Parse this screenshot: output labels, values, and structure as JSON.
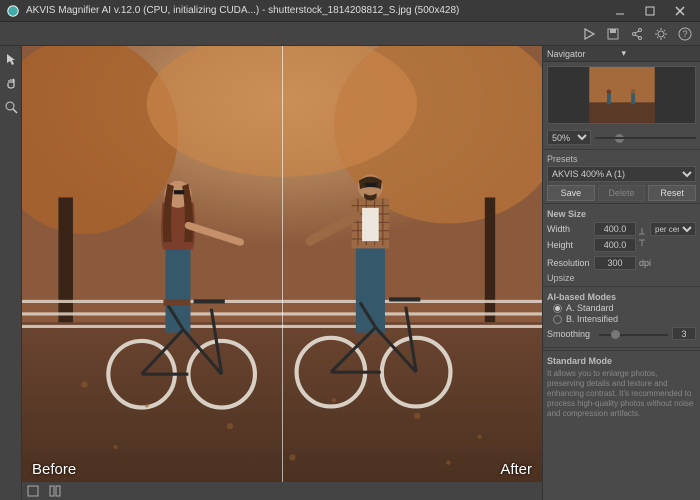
{
  "titlebar": {
    "title": "AKVIS Magnifier AI v.12.0 (CPU, initializing CUDA...) - shutterstock_1814208812_S.jpg (500x428)"
  },
  "canvas": {
    "before_label": "Before",
    "after_label": "After"
  },
  "navigator": {
    "header": "Navigator",
    "zoom": "50%"
  },
  "presets": {
    "header": "Presets",
    "selected": "AKVIS 400% A (1)",
    "save": "Save",
    "delete": "Delete",
    "reset": "Reset"
  },
  "newsize": {
    "header": "New Size",
    "width_label": "Width",
    "width_value": "400.0",
    "height_label": "Height",
    "height_value": "400.0",
    "unit": "per cent",
    "res_label": "Resolution",
    "res_value": "300",
    "res_unit": "dpi",
    "upsize": "Upsize"
  },
  "modes": {
    "header": "AI-based Modes",
    "a": "A. Standard",
    "b": "B. Intensified"
  },
  "smoothing": {
    "label": "Smoothing",
    "value": "3"
  },
  "standard": {
    "header": "Standard Mode",
    "desc": "It allows you to enlarge photos, preserving details and texture and enhancing contrast. It's recommended to process high-quality photos without noise and compression artifacts."
  }
}
